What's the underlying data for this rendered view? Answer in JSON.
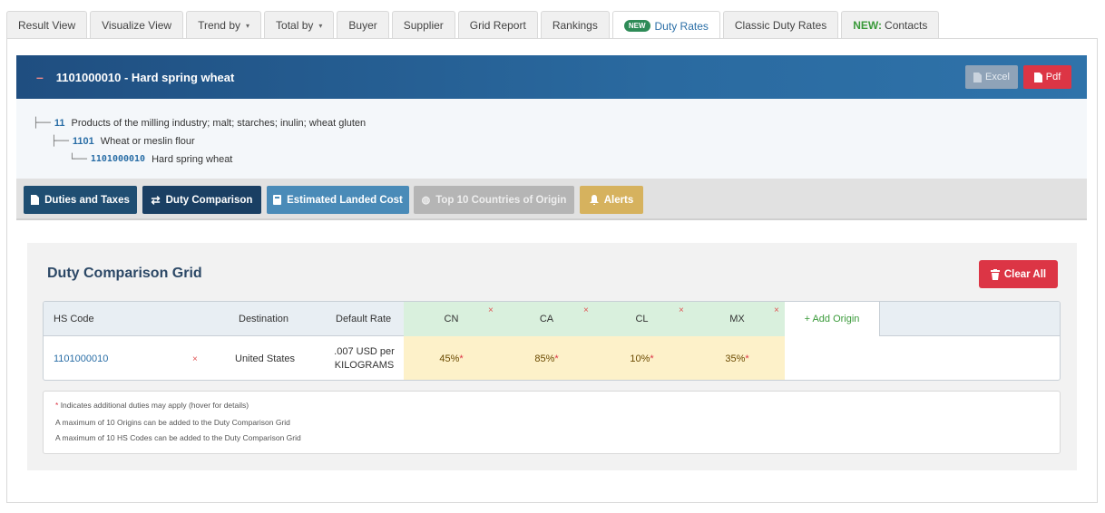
{
  "tabs": [
    {
      "label": "Result View"
    },
    {
      "label": "Visualize View"
    },
    {
      "label": "Trend by",
      "caret": "▾"
    },
    {
      "label": "Total by",
      "caret": "▾"
    },
    {
      "label": "Buyer"
    },
    {
      "label": "Supplier"
    },
    {
      "label": "Grid Report"
    },
    {
      "label": "Rankings"
    },
    {
      "label": "Duty Rates",
      "badge": "NEW",
      "active": true
    },
    {
      "label": "Classic Duty Rates"
    },
    {
      "label": "Contacts",
      "prefix": "NEW:"
    }
  ],
  "header": {
    "collapse_symbol": "–",
    "title": "1101000010 - Hard spring wheat",
    "excel_label": "Excel",
    "pdf_label": "Pdf"
  },
  "hierarchy": [
    {
      "code": "11",
      "description": "Products of the milling industry; malt; starches; inulin; wheat gluten"
    },
    {
      "code": "1101",
      "description": "Wheat or meslin flour"
    },
    {
      "code": "1101000010",
      "description": "Hard spring wheat"
    }
  ],
  "actions": {
    "duties_taxes": "Duties and Taxes",
    "duty_comparison": "Duty Comparison",
    "landed_cost": "Estimated Landed Cost",
    "top10": "Top 10 Countries of Origin",
    "alerts": "Alerts"
  },
  "grid": {
    "title": "Duty Comparison Grid",
    "clear_all_label": "Clear All",
    "columns": {
      "hs_code": "HS Code",
      "destination": "Destination",
      "default_rate": "Default Rate",
      "add_origin": "+ Add Origin"
    },
    "origins": [
      "CN",
      "CA",
      "CL",
      "MX"
    ],
    "remove_symbol": "×",
    "row": {
      "hs_code": "1101000010",
      "destination": "United States",
      "default_rate_line1": ".007 USD per",
      "default_rate_line2": "KILOGRAMS",
      "rates": [
        "45%",
        "85%",
        "10%",
        "35%"
      ],
      "rate_marker": "*"
    }
  },
  "notes": {
    "marker": "*",
    "line1": "Indicates additional duties may apply (hover for details)",
    "line2": "A maximum of 10 Origins can be added to the Duty Comparison Grid",
    "line3": "A maximum of 10 HS Codes can be added to the Duty Comparison Grid"
  },
  "colors": {
    "header_blue": "#1f4e80",
    "pdf_red": "#dc3545",
    "origin_header_green": "#d9f0dd",
    "rate_cell_yellow": "#fdf1c9",
    "link_blue": "#2a6ea6"
  }
}
